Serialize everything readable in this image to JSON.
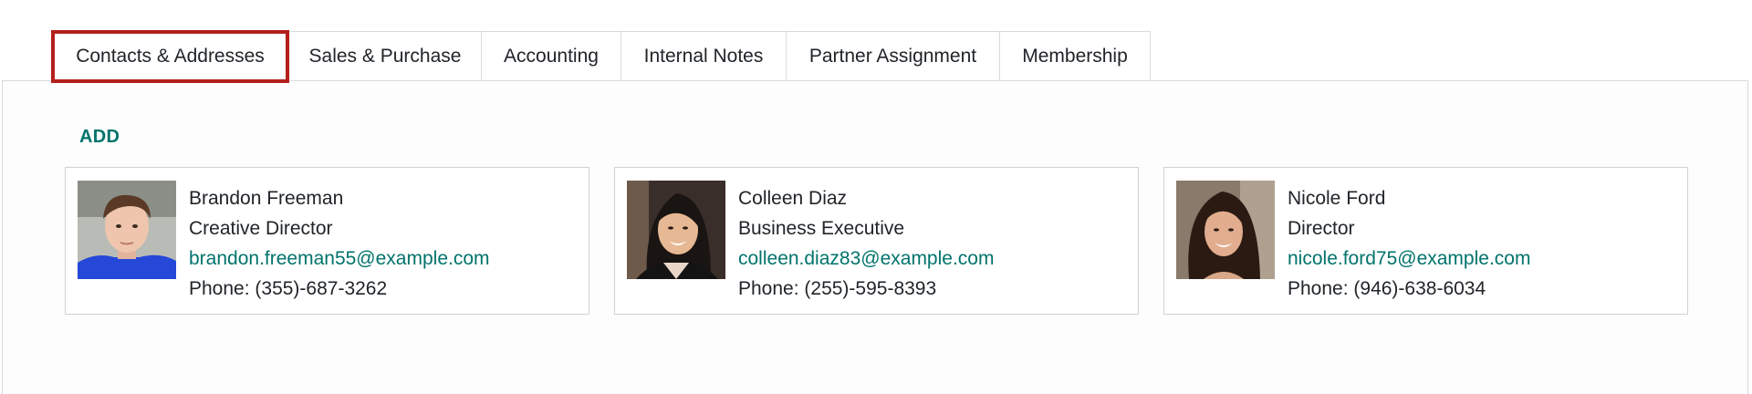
{
  "tabs": [
    {
      "label": "Contacts & Addresses",
      "active": true
    },
    {
      "label": "Sales & Purchase",
      "active": false
    },
    {
      "label": "Accounting",
      "active": false
    },
    {
      "label": "Internal Notes",
      "active": false
    },
    {
      "label": "Partner Assignment",
      "active": false
    },
    {
      "label": "Membership",
      "active": false
    }
  ],
  "contacts": {
    "add_label": "ADD",
    "items": [
      {
        "name": "Brandon Freeman",
        "title": "Creative Director",
        "email": "brandon.freeman55@example.com",
        "phone": "Phone: (355)-687-3262"
      },
      {
        "name": "Colleen Diaz",
        "title": "Business Executive",
        "email": "colleen.diaz83@example.com",
        "phone": "Phone: (255)-595-8393"
      },
      {
        "name": "Nicole Ford",
        "title": "Director",
        "email": "nicole.ford75@example.com",
        "phone": "Phone: (946)-638-6034"
      }
    ]
  },
  "colors": {
    "accent": "#01736b",
    "active_tab_border": "#b3201b",
    "border": "#d8dadd"
  }
}
